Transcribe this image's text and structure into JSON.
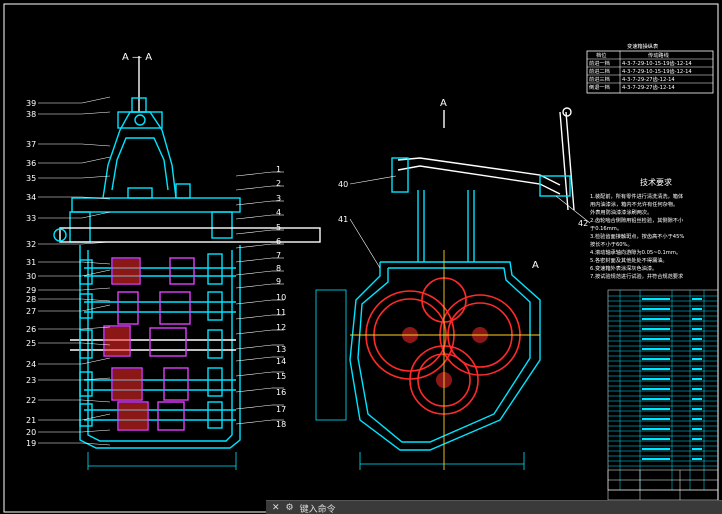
{
  "section_left": "A — A",
  "section_right_top": "A",
  "section_right_side": "A",
  "leaders_left": [
    "39",
    "38",
    "37",
    "36",
    "35",
    "34",
    "33",
    "32",
    "31",
    "30",
    "29",
    "28",
    "27",
    "26",
    "25",
    "24",
    "23",
    "22",
    "21",
    "20",
    "19"
  ],
  "leaders_right": [
    "1",
    "2",
    "3",
    "4",
    "5",
    "6",
    "7",
    "8",
    "9",
    "10",
    "11",
    "12",
    "13",
    "14",
    "15",
    "16",
    "17",
    "18"
  ],
  "leaders_right_view": [
    "40",
    "41",
    "42"
  ],
  "table": {
    "title": "变速箱操纵表",
    "headers": [
      "档位",
      "传动路线"
    ],
    "rows": [
      [
        "前进一档",
        "4-3-7-29-10-15-19齿-12-14"
      ],
      [
        "前进二档",
        "4-3-7-29-10-15-19齿-12-14"
      ],
      [
        "前进三档",
        "4-3-7-29-27齿-12-14"
      ],
      [
        "倒退一档",
        "4-3-7-29-27齿-12-14"
      ]
    ]
  },
  "tech": {
    "title": "技术要求",
    "lines": [
      "1.装配前，所有零件进行清洗清洗，箱体",
      "  用内油漆涂，箱内不允许有任何杂物。",
      "  外表用防油漆漆涂刷两次。",
      "2.齿轮啮合侧隙用铅丝检验，其侧隙不小",
      "  于0.16mm。",
      "3.检验齿面接触斑点，按齿高不小于45%",
      "  按长不小于60%。",
      "4.滚动轴承轴向游隙为0.05~0.1mm。",
      "5.各密封面及其他处处不得漏油。",
      "6.变速箱外表涂深灰色油漆。",
      "7.按试验规范进行试验，并符合规范要求"
    ]
  },
  "command_bar": {
    "label": "键入命令"
  },
  "colors": {
    "bg": "#000000",
    "cyan": "#00e5ff",
    "red": "#ff2a2a",
    "white": "#ffffff",
    "yellow": "#ffd21f",
    "magenta": "#e040fb",
    "green": "#39ff14"
  }
}
